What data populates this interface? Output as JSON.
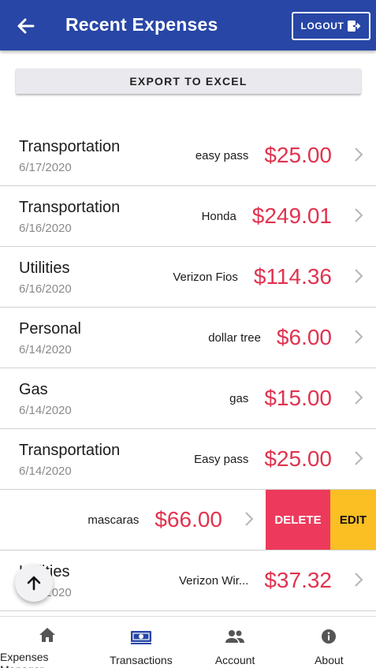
{
  "header": {
    "title": "Recent Expenses",
    "logout_label": "LOGOUT",
    "back_icon": "arrow-left-icon",
    "logout_icon": "logout-icon",
    "color": "#2746a6"
  },
  "export_button": {
    "label": "EXPORT TO EXCEL"
  },
  "expenses": [
    {
      "category": "Transportation",
      "date": "6/17/2020",
      "description": "easy pass",
      "amount": "$25.00"
    },
    {
      "category": "Transportation",
      "date": "6/16/2020",
      "description": "Honda",
      "amount": "$249.01"
    },
    {
      "category": "Utilities",
      "date": "6/16/2020",
      "description": "Verizon Fios",
      "amount": "$114.36"
    },
    {
      "category": "Personal",
      "date": "6/14/2020",
      "description": "dollar tree",
      "amount": "$6.00"
    },
    {
      "category": "Gas",
      "date": "6/14/2020",
      "description": "gas",
      "amount": "$15.00"
    },
    {
      "category": "Transportation",
      "date": "6/14/2020",
      "description": "Easy pass",
      "amount": "$25.00"
    },
    {
      "category": "",
      "date": "",
      "description": "mascaras",
      "amount": "$66.00"
    },
    {
      "category": "Utilities",
      "date": "6/14/2020",
      "description": "Verizon Wir...",
      "amount": "$37.32"
    }
  ],
  "row_actions": {
    "delete_label": "DELETE",
    "edit_label": "EDIT",
    "delete_color": "#ed3a5c",
    "edit_color": "#fbbf24"
  },
  "amount_color": "#e0334f",
  "tabs": [
    {
      "label": "Expenses Manager",
      "icon": "home-icon"
    },
    {
      "label": "Transactions",
      "icon": "money-icon",
      "active": true
    },
    {
      "label": "Account",
      "icon": "people-icon"
    },
    {
      "label": "About",
      "icon": "info-icon"
    }
  ],
  "fab": {
    "icon": "arrow-up-icon"
  }
}
